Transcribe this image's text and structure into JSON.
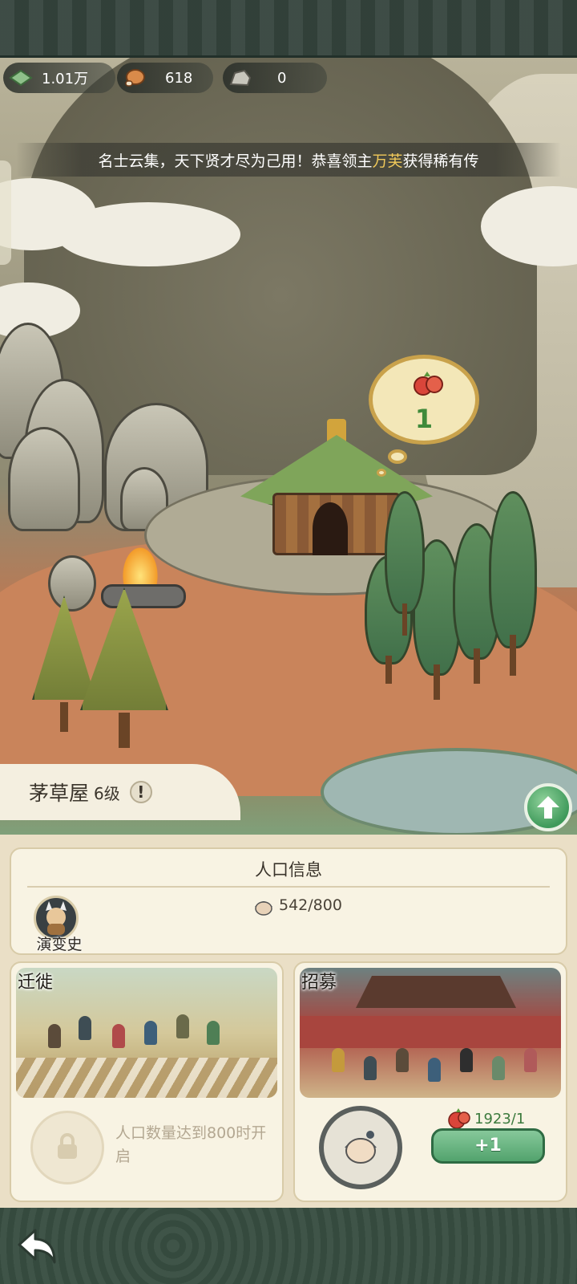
{
  "resources": [
    {
      "icon": "jade-icon",
      "value": "1.01万"
    },
    {
      "icon": "meat-icon",
      "value": "618"
    },
    {
      "icon": "stone-icon",
      "value": "0"
    }
  ],
  "broadcast": {
    "prefix": "名士云集，天下贤才尽为己用！恭喜领主",
    "player": "万芙",
    "suffix": "获得稀有传"
  },
  "scene": {
    "bubble_count": "1",
    "bubble_icon": "fruit-icon"
  },
  "building": {
    "name": "茅草屋",
    "level": "6级",
    "info": "!"
  },
  "population": {
    "title": "人口信息",
    "evolution_label": "演变史",
    "count": "542/800"
  },
  "migrate": {
    "title": "迁徙",
    "locked_text": "人口数量达到800时开启"
  },
  "recruit": {
    "title": "招募",
    "cost": "1923/1",
    "button": "+1"
  },
  "colors": {
    "accent_green": "#52a36d",
    "highlight_gold": "#f0c95a",
    "panel_bg": "#eadfc6"
  }
}
